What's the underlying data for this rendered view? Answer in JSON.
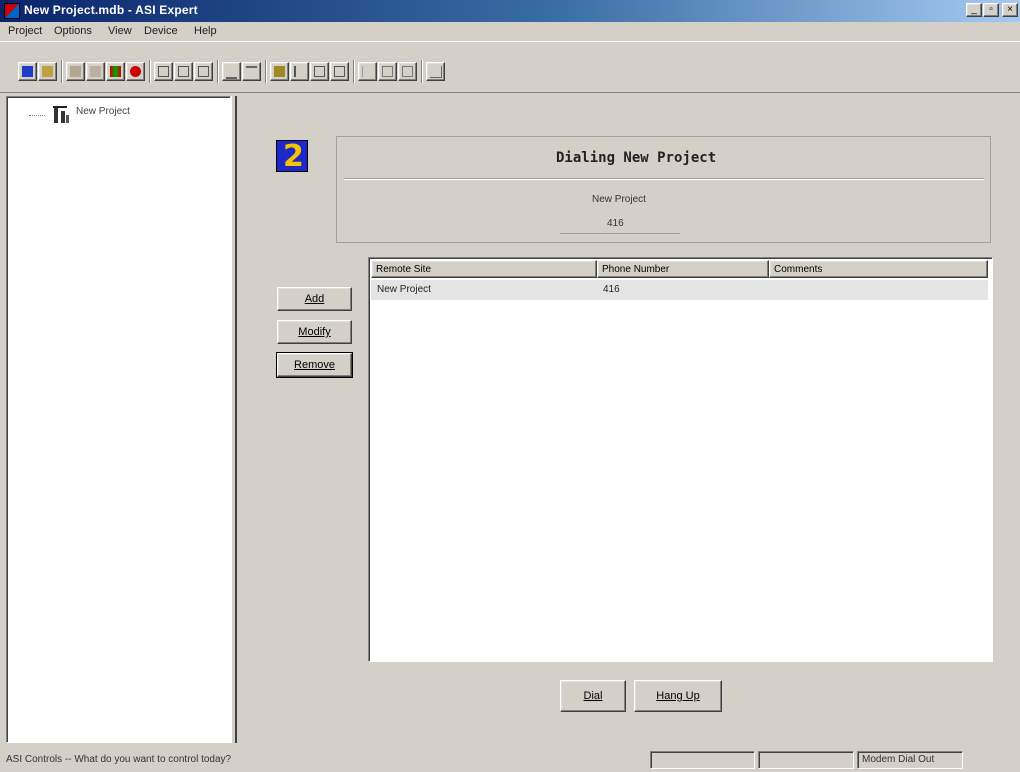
{
  "window": {
    "title": "New Project.mdb - ASI Expert"
  },
  "menu": [
    "Project",
    "Options",
    "View",
    "Device",
    "Help"
  ],
  "toolbar": {
    "buttons": [
      "new-icon",
      "open-icon",
      "cut-icon",
      "copy-icon",
      "site-icon",
      "stop-icon",
      "panel-a-icon",
      "panel-b-icon",
      "panel-c-icon",
      "sort-up-icon",
      "sort-down-icon",
      "monitor-icon",
      "text-icon",
      "grid-icon",
      "chart-icon",
      "table-a-icon",
      "table-b-icon",
      "table-c-icon",
      "wizard-icon"
    ]
  },
  "tree": {
    "root_label": "New Project"
  },
  "dialog": {
    "title": "Dialing New Project",
    "project_name": "New Project",
    "project_number": "416",
    "buttons": {
      "add": "Add",
      "modify": "Modify",
      "remove": "Remove",
      "dial": "Dial",
      "hangup": "Hang Up"
    },
    "columns": [
      "Remote Site",
      "Phone Number",
      "Comments"
    ],
    "rows": [
      {
        "site": "New Project",
        "phone": "416",
        "comments": ""
      }
    ]
  },
  "status": {
    "message": "ASI Controls -- What do you want to control today?",
    "right": "Modem Dial Out"
  }
}
